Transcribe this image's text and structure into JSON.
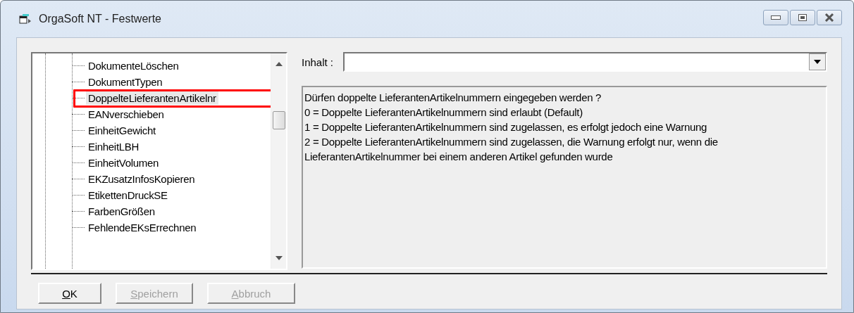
{
  "window": {
    "title": "OrgaSoft NT - Festwerte"
  },
  "tree": {
    "items": [
      {
        "label": "DokumenteLöschen",
        "selected": false
      },
      {
        "label": "DokumentTypen",
        "selected": false
      },
      {
        "label": "DoppelteLieferantenArtikelnr",
        "selected": true
      },
      {
        "label": "EANverschieben",
        "selected": false
      },
      {
        "label": "EinheitGewicht",
        "selected": false
      },
      {
        "label": "EinheitLBH",
        "selected": false
      },
      {
        "label": "EinheitVolumen",
        "selected": false
      },
      {
        "label": "EKZusatzInfosKopieren",
        "selected": false
      },
      {
        "label": "EtikettenDruckSE",
        "selected": false
      },
      {
        "label": "FarbenGrößen",
        "selected": false
      },
      {
        "label": "FehlendeEKsErrechnen",
        "selected": false
      }
    ]
  },
  "content": {
    "label": "Inhalt :",
    "description": [
      "Dürfen doppelte LieferantenArtikelnummern eingegeben werden ?",
      "0 = Doppelte LieferantenArtikelnummern sind erlaubt (Default)",
      "1 = Doppelte LieferantenArtikelnummern sind zugelassen, es erfolgt jedoch eine Warnung",
      "2 = Doppelte LieferantenArtikelnummern sind zugelassen, die Warnung erfolgt nur, wenn die LieferantenArtikelnummer bei einem anderen Artikel gefunden wurde"
    ]
  },
  "buttons": [
    {
      "label": "OK",
      "disabled": false
    },
    {
      "label": "Speichern",
      "disabled": true
    },
    {
      "label": "Abbruch",
      "disabled": true
    }
  ]
}
